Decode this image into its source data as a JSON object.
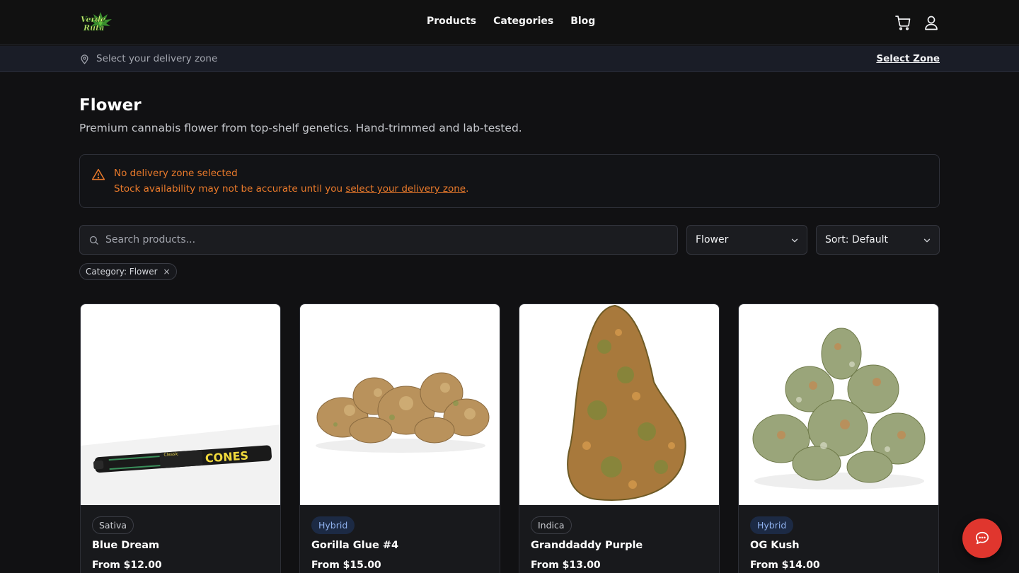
{
  "header": {
    "logo_text": "Verde Ruta",
    "nav": [
      {
        "label": "Products"
      },
      {
        "label": "Categories"
      },
      {
        "label": "Blog"
      }
    ],
    "icons": [
      "shopping-cart-icon",
      "user-icon"
    ]
  },
  "delivery_bar": {
    "text": "Select your delivery zone",
    "action": "Select Zone"
  },
  "page": {
    "title": "Flower",
    "subtitle": "Premium cannabis flower from top-shelf genetics. Hand-trimmed and lab-tested."
  },
  "alert": {
    "title": "No delivery zone selected",
    "message_prefix": "Stock availability may not be accurate until you ",
    "link": "select your delivery zone",
    "message_suffix": ".",
    "color": "#ea7a2b"
  },
  "filters": {
    "search_placeholder": "Search products...",
    "category_value": "Flower",
    "sort_value": "Sort: Default",
    "active_chip": "Category: Flower",
    "chip_remove": "×"
  },
  "products": [
    {
      "type": "Sativa",
      "name": "Blue Dream",
      "price": "From $12.00",
      "image": "pre-rolled-cone"
    },
    {
      "type": "Hybrid",
      "name": "Gorilla Glue #4",
      "price": "From $15.00",
      "image": "flower-buds"
    },
    {
      "type": "Indica",
      "name": "Granddaddy Purple",
      "price": "From $13.00",
      "image": "single-bud"
    },
    {
      "type": "Hybrid",
      "name": "OG Kush",
      "price": "From $14.00",
      "image": "bud-pile"
    }
  ],
  "chat": {
    "icon": "chat-bubble-icon",
    "color": "#e0362e"
  }
}
